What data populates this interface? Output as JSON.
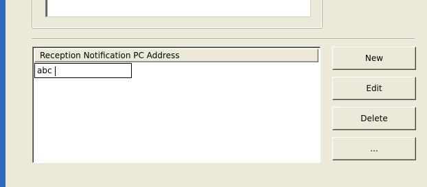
{
  "list": {
    "column_header": "Reception Notification PC Address",
    "editing_value": "abc"
  },
  "buttons": {
    "new_label": "New",
    "edit_label": "Edit",
    "delete_label": "Delete",
    "more_label": "..."
  },
  "colors": {
    "window_bg": "#ece9d8",
    "accent_bar": "#2f67bf"
  }
}
